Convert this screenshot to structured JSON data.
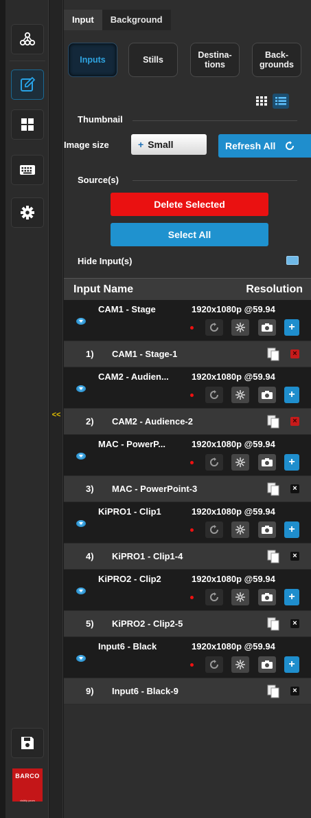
{
  "tabs": [
    "Input",
    "Background"
  ],
  "segments": [
    {
      "label": "Inputs",
      "active": true
    },
    {
      "label": "Stills",
      "active": false
    },
    {
      "label": "Destina-\ntions",
      "active": false
    },
    {
      "label": "Back-\ngrounds",
      "active": false
    }
  ],
  "thumbnail": {
    "section_label": "Thumbnail",
    "image_size_label": "Image size",
    "image_size_value": "Small",
    "refresh_label": "Refresh All"
  },
  "sources": {
    "section_label": "Source(s)",
    "delete_label": "Delete Selected",
    "select_all_label": "Select All",
    "hide_inputs_label": "Hide Input(s)"
  },
  "list_header": {
    "name": "Input Name",
    "resolution": "Resolution"
  },
  "inputs": [
    {
      "name": "CAM1 - Stage",
      "resolution": "1920x1080p @59.94",
      "still_num": "1)",
      "still_name": "CAM1 - Stage-1",
      "still_delete_style": "red"
    },
    {
      "name": "CAM2 - Audien...",
      "resolution": "1920x1080p @59.94",
      "still_num": "2)",
      "still_name": "CAM2 - Audience-2",
      "still_delete_style": "red"
    },
    {
      "name": "MAC - PowerP...",
      "resolution": "1920x1080p @59.94",
      "still_num": "3)",
      "still_name": "MAC - PowerPoint-3",
      "still_delete_style": "dark"
    },
    {
      "name": "KiPRO1 - Clip1",
      "resolution": "1920x1080p @59.94",
      "still_num": "4)",
      "still_name": "KiPRO1 - Clip1-4",
      "still_delete_style": "dark"
    },
    {
      "name": "KiPRO2 - Clip2",
      "resolution": "1920x1080p @59.94",
      "still_num": "5)",
      "still_name": "KiPRO2 - Clip2-5",
      "still_delete_style": "dark"
    },
    {
      "name": "Input6 - Black",
      "resolution": "1920x1080p @59.94",
      "still_num": "9)",
      "still_name": "Input6 - Black-9",
      "still_delete_style": "dark"
    }
  ],
  "rail_icons": [
    "network-icon",
    "edit-icon",
    "layout-icon",
    "keyboard-icon",
    "gear-icon",
    "save-icon"
  ],
  "collapse_symbol": "<<",
  "logo": {
    "brand": "BARCO",
    "sub": "visibly yours"
  },
  "colors": {
    "accent_blue": "#1f8ecd",
    "danger_red": "#ea1111",
    "logo_red": "#c41618",
    "collapse_yellow": "#e6c200"
  }
}
